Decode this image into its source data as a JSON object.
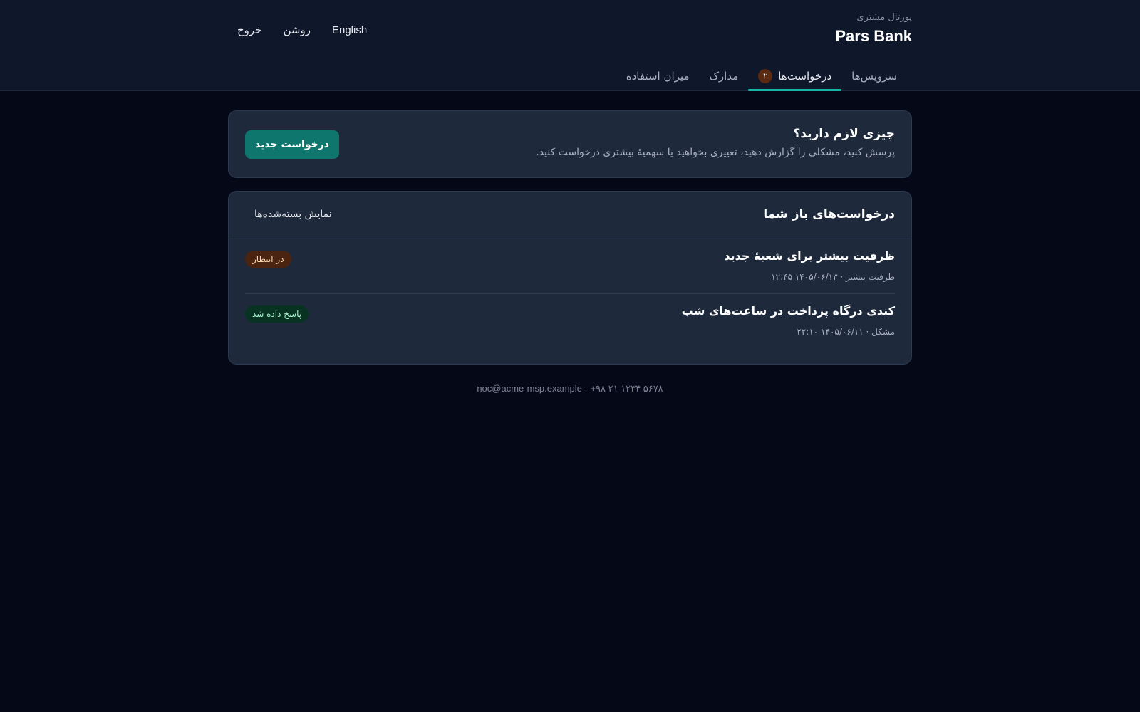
{
  "header": {
    "subtitle": "پورتال مشتری",
    "brand": "Pars Bank",
    "actions": {
      "language": "English",
      "theme": "روشن",
      "logout": "خروج"
    }
  },
  "tabs": [
    {
      "label": "سرویس‌ها",
      "active": false
    },
    {
      "label": "درخواست‌ها",
      "active": true,
      "badge": "۲"
    },
    {
      "label": "مدارک",
      "active": false
    },
    {
      "label": "میزان استفاده",
      "active": false
    }
  ],
  "cta": {
    "title": "چیزی لازم دارید؟",
    "description": "پرسش کنید، مشکلی را گزارش دهید، تغییری بخواهید یا سهمیهٔ بیشتری درخواست کنید.",
    "button": "درخواست جدید"
  },
  "requests": {
    "title": "درخواست‌های باز شما",
    "show_closed": "نمایش بسته‌شده‌ها",
    "items": [
      {
        "title": "ظرفیت بیشتر برای شعبهٔ جدید",
        "meta": "ظرفیت بیشتر · ۱۴۰۵/۰۶/۱۳ ۱۲:۴۵",
        "status": "در انتظار"
      },
      {
        "title": "کندی درگاه پرداخت در ساعت‌های شب",
        "meta": "مشکل · ۱۴۰۵/۰۶/۱۱ ۲۲:۱۰",
        "status": "پاسخ داده شد"
      }
    ]
  },
  "footer": {
    "contact": "noc@acme-msp.example · +۹۸ ۲۱ ۱۲۳۴ ۵۶۷۸"
  },
  "colors": {
    "accent": "#14b8a6",
    "button": "#0f766e",
    "pending": "#4a2410",
    "answered": "#083322"
  }
}
